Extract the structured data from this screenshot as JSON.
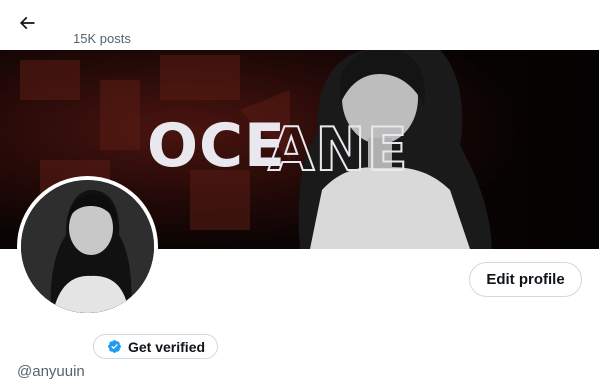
{
  "header": {
    "post_count": "15K posts",
    "back_icon": "arrow-left-icon"
  },
  "banner": {
    "title": "OCEANE",
    "title_solid": "OCE",
    "title_outline": "ANE"
  },
  "profile": {
    "edit_label": "Edit profile",
    "verify_label": "Get verified",
    "verify_icon": "verified-badge-icon",
    "verify_color": "#1d9bf0",
    "handle": "@anyuuin"
  }
}
